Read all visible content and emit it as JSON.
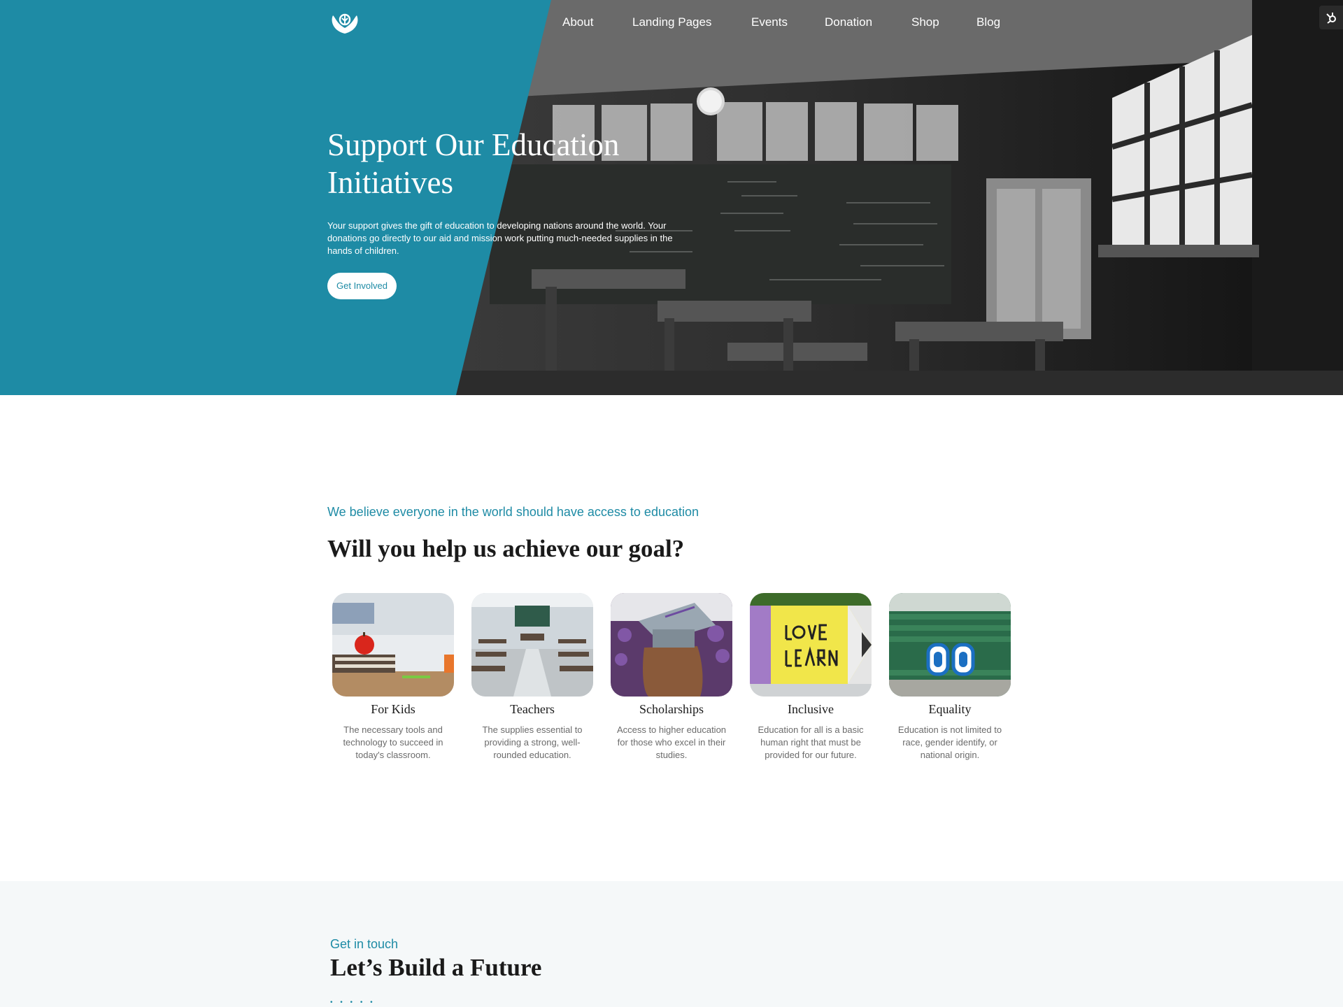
{
  "nav": {
    "items": [
      "About",
      "Landing Pages",
      "Events",
      "Donation",
      "Shop",
      "Blog"
    ]
  },
  "hero": {
    "title_line1": "Support Our Education",
    "title_line2": "Initiatives",
    "text": "Your support gives the gift of education to developing nations around the world. Your donations go directly to our aid and mission work putting much-needed supplies in the hands of children.",
    "button_label": "Get Involved"
  },
  "goal": {
    "eyebrow": "We believe everyone in the world should have access to education",
    "title": "Will you help us achieve our goal?",
    "cards": [
      {
        "title": "For Kids",
        "text": "The necessary tools and technology to succeed in today's classroom."
      },
      {
        "title": "Teachers",
        "text": "The supplies essential to providing a strong, well-rounded education."
      },
      {
        "title": "Scholarships",
        "text": "Access to higher education for those who excel in their studies."
      },
      {
        "title": "Inclusive",
        "text": "Education for all is a basic human right that must be provided for our future."
      },
      {
        "title": "Equality",
        "text": "Education is not limited to race, gender identify, or national origin."
      }
    ]
  },
  "contact": {
    "eyebrow": "Get in touch",
    "title": "Let’s Build a Future"
  },
  "colors": {
    "teal": "#1e8ba5",
    "dark_text": "#1a1a1a",
    "muted_text": "#6b6b6b",
    "contact_bg": "#f5f8f9"
  },
  "icons": [
    "logo-hands-icon",
    "hubspot-sprocket-icon"
  ]
}
